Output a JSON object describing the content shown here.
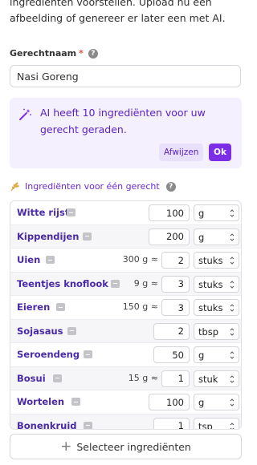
{
  "intro": {
    "line1": "ingrediënten voorstellen. Upload nu een",
    "line2": "afbeelding of genereer er later een met AI."
  },
  "dish_name": {
    "label": "Gerechtnaam",
    "required_marker": "*",
    "help": "?",
    "value": "Nasi Goreng"
  },
  "ai_notice": {
    "text": "AI heeft 10 ingrediënten voor uw gerecht geraden.",
    "reject_label": "Afwijzen",
    "ok_label": "Ok"
  },
  "ingredients_section": {
    "title": "Ingrediënten voor één gerecht",
    "help": "?"
  },
  "ingredients": [
    {
      "name": "Witte rijst",
      "approx": "",
      "qty": "100",
      "unit": "g"
    },
    {
      "name": "Kippendijen",
      "approx": "",
      "qty": "200",
      "unit": "g"
    },
    {
      "name": "Uien",
      "approx": "300 g ≈",
      "qty": "2",
      "unit": "stuks"
    },
    {
      "name": "Teentjes knoflook",
      "approx": "9 g ≈",
      "qty": "3",
      "unit": "stuks"
    },
    {
      "name": "Eieren",
      "approx": "150 g ≈",
      "qty": "3",
      "unit": "stuks"
    },
    {
      "name": "Sojasaus",
      "approx": "",
      "qty": "2",
      "unit": "tbsp"
    },
    {
      "name": "Seroendeng",
      "approx": "",
      "qty": "50",
      "unit": "g"
    },
    {
      "name": "Bosui",
      "approx": "15 g ≈",
      "qty": "1",
      "unit": "stuk"
    },
    {
      "name": "Wortelen",
      "approx": "",
      "qty": "100",
      "unit": "g"
    },
    {
      "name": "Bonenkruid",
      "approx": "",
      "qty": "1",
      "unit": "tsp"
    }
  ],
  "add_button": {
    "label": "Selecteer ingrediënten",
    "icon": "plus-icon"
  },
  "colors": {
    "accent": "#7c2ee6",
    "ai_bg": "#f4f0fd",
    "ingredient_name": "#4a2aa8"
  }
}
